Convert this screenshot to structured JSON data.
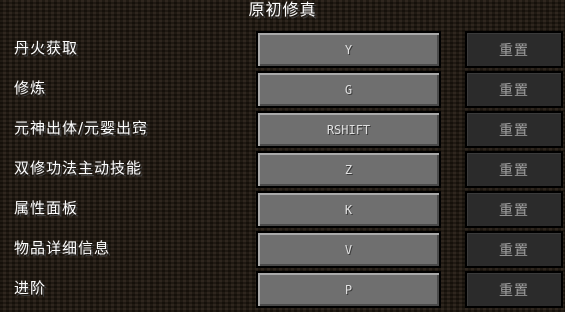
{
  "title": "原初修真",
  "reset_label": "重置",
  "bindings": [
    {
      "action": "丹火获取",
      "key": "Y"
    },
    {
      "action": "修炼",
      "key": "G"
    },
    {
      "action": "元神出体/元婴出窍",
      "key": "RSHIFT"
    },
    {
      "action": "双修功法主动技能",
      "key": "Z"
    },
    {
      "action": "属性面板",
      "key": "K"
    },
    {
      "action": "物品详细信息",
      "key": "V"
    },
    {
      "action": "进阶",
      "key": "P"
    }
  ]
}
